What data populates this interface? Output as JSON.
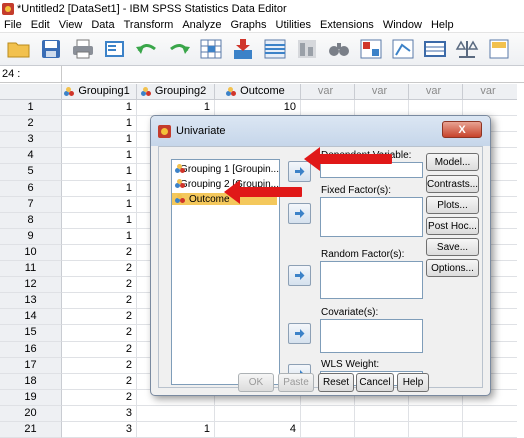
{
  "window": {
    "title": "*Untitled2 [DataSet1] - IBM SPSS Statistics Data Editor"
  },
  "menu": [
    {
      "label": "File"
    },
    {
      "label": "Edit"
    },
    {
      "label": "View"
    },
    {
      "label": "Data"
    },
    {
      "label": "Transform"
    },
    {
      "label": "Analyze"
    },
    {
      "label": "Graphs"
    },
    {
      "label": "Utilities"
    },
    {
      "label": "Extensions"
    },
    {
      "label": "Window"
    },
    {
      "label": "Help"
    }
  ],
  "toolbar": {
    "icons": [
      "open-folder-icon",
      "save-icon",
      "print-icon",
      "dialog-recall-icon",
      "undo-icon",
      "redo-icon",
      "goto-case-icon",
      "goto-variable-icon",
      "variables-icon",
      "run-descriptive-icon",
      "find-icon",
      "insert-cases-icon",
      "insert-variable-icon",
      "split-file-icon",
      "weight-cases-icon",
      "select-cases-icon"
    ]
  },
  "cellref": {
    "value": "24 :"
  },
  "grid": {
    "headers": [
      "Grouping1",
      "Grouping2",
      "Outcome",
      "var",
      "var",
      "var",
      "var"
    ],
    "rows": [
      {
        "n": "1",
        "g1": "1",
        "g2": "1",
        "o": "10"
      },
      {
        "n": "2",
        "g1": "1",
        "g2": "",
        "o": ""
      },
      {
        "n": "3",
        "g1": "1",
        "g2": "",
        "o": ""
      },
      {
        "n": "4",
        "g1": "1",
        "g2": "",
        "o": ""
      },
      {
        "n": "5",
        "g1": "1",
        "g2": "",
        "o": ""
      },
      {
        "n": "6",
        "g1": "1",
        "g2": "",
        "o": ""
      },
      {
        "n": "7",
        "g1": "1",
        "g2": "",
        "o": ""
      },
      {
        "n": "8",
        "g1": "1",
        "g2": "",
        "o": ""
      },
      {
        "n": "9",
        "g1": "1",
        "g2": "",
        "o": ""
      },
      {
        "n": "10",
        "g1": "2",
        "g2": "",
        "o": ""
      },
      {
        "n": "11",
        "g1": "2",
        "g2": "",
        "o": ""
      },
      {
        "n": "12",
        "g1": "2",
        "g2": "",
        "o": ""
      },
      {
        "n": "13",
        "g1": "2",
        "g2": "",
        "o": ""
      },
      {
        "n": "14",
        "g1": "2",
        "g2": "",
        "o": ""
      },
      {
        "n": "15",
        "g1": "2",
        "g2": "",
        "o": ""
      },
      {
        "n": "16",
        "g1": "2",
        "g2": "",
        "o": ""
      },
      {
        "n": "17",
        "g1": "2",
        "g2": "",
        "o": ""
      },
      {
        "n": "18",
        "g1": "2",
        "g2": "",
        "o": ""
      },
      {
        "n": "19",
        "g1": "2",
        "g2": "",
        "o": ""
      },
      {
        "n": "20",
        "g1": "3",
        "g2": "",
        "o": ""
      },
      {
        "n": "21",
        "g1": "3",
        "g2": "1",
        "o": "4"
      }
    ]
  },
  "dialog": {
    "title": "Univariate",
    "close": "X",
    "source_items": [
      "Grouping 1 [Groupin...",
      "Grouping 2 [Groupin...",
      "Outcome"
    ],
    "targets": {
      "dependent": "Dependent Variable:",
      "fixed": "Fixed Factor(s):",
      "random": "Random Factor(s):",
      "covariate": "Covariate(s):",
      "wls": "WLS Weight:"
    },
    "side_buttons": [
      "Model...",
      "Contrasts...",
      "Plots...",
      "Post Hoc...",
      "Save...",
      "Options..."
    ],
    "bottom_buttons": {
      "ok": "OK",
      "paste": "Paste",
      "reset": "Reset",
      "cancel": "Cancel",
      "help": "Help"
    }
  },
  "colors": {
    "annotation_arrow": "#e01818",
    "selection": "#f4c85c",
    "accent": "#3c82c8"
  }
}
